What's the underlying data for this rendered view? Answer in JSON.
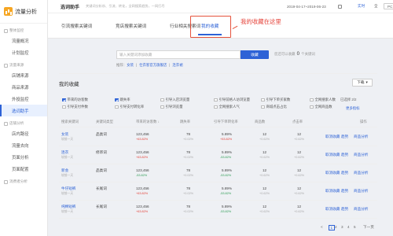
{
  "sidebar": {
    "brand": "流量分析",
    "groups": [
      {
        "label": "整体监控",
        "items": [
          "流量概况",
          "计划监控"
        ]
      },
      {
        "label": "流量来源",
        "items": [
          "店铺来源",
          "商品来源",
          "外投监控",
          "选词助手"
        ]
      },
      {
        "label": "店铺分析",
        "items": [
          "店内路径",
          "流量去向",
          "页面分析",
          "页面配置"
        ]
      },
      {
        "label": "消费者分析",
        "items": []
      }
    ],
    "active_item": "选词助手"
  },
  "topbar": {
    "title": "选词助手",
    "desc": "关键词分析析、引流、转化，全网搜索趋势，一网打尽",
    "date_range": "2019-04-17~2019-06-23",
    "link": "实时",
    "dropdown": "全",
    "device": "PC"
  },
  "tabs": [
    "引流搜索关键词",
    "竞店搜索关键词",
    "行业相关搜索词",
    "我的收藏"
  ],
  "annotation": "我的收藏在这里",
  "search": {
    "placeholder": "输入关键词添加收藏",
    "button": "收藏",
    "hint_prefix": "您还可以收藏",
    "hint_count": "0",
    "hint_suffix": "个关键词",
    "recommend_label": "推荐：",
    "recommend_items": [
      "女装",
      "仕衣客官方旗舰店",
      "连衣裙"
    ]
  },
  "favorites": {
    "title": "我的收藏",
    "download": "下载",
    "checkboxes": [
      {
        "label": "带来的访客数",
        "checked": true
      },
      {
        "label": "跳失率",
        "checked": true
      },
      {
        "label": "引导入店浏览量",
        "checked": false
      },
      {
        "label": "引导前格人访浏览量",
        "checked": false
      },
      {
        "label": "引导下单买家数",
        "checked": false
      },
      {
        "label": "全网搜索人数",
        "checked": false
      },
      {
        "label": "引导支付件数",
        "checked": false
      },
      {
        "label": "引导支付转化率",
        "checked": false
      },
      {
        "label": "引导浏览量",
        "checked": false
      },
      {
        "label": "全网搜索人气",
        "checked": false
      },
      {
        "label": "商城点击占比",
        "checked": false
      },
      {
        "label": "全网商品数",
        "checked": false
      }
    ],
    "selected": "已选择 2/2",
    "more": "更多指标",
    "columns": [
      "搜索关键词",
      "关键词类型",
      "带来的访客数",
      "跳失率",
      "引导下单转化率",
      "商品数",
      "点击率",
      "操作"
    ],
    "rows": [
      {
        "kw": "女装",
        "type": "品类词",
        "visitors": "123,456",
        "visitors_delta": "+63.82%",
        "bounce": "78",
        "bounce_delta": "+0.02%",
        "conv": "5.89%",
        "conv_delta": "+53.82%",
        "items": "12",
        "items_delta": "+0.62%",
        "click": "12",
        "click_delta": "+0.62%",
        "delta_dir": "up"
      },
      {
        "kw": "连衣",
        "type": "修饰词",
        "visitors": "123,456",
        "visitors_delta": "+63.82%",
        "bounce": "78",
        "bounce_delta": "+0.02%",
        "conv": "5.89%",
        "conv_delta": "-53.82%",
        "items": "12",
        "items_delta": "+0.62%",
        "click": "12",
        "click_delta": "+0.62%",
        "delta_dir": "mix"
      },
      {
        "kw": "新会",
        "type": "品类词",
        "visitors": "123,456",
        "visitors_delta": "-53.82%",
        "bounce": "78",
        "bounce_delta": "+0.02%",
        "conv": "5.89%",
        "conv_delta": "-53.82%",
        "items": "12",
        "items_delta": "+0.62%",
        "click": "12",
        "click_delta": "+0.62%",
        "delta_dir": "down"
      },
      {
        "kw": "牛仔短裤",
        "type": "长尾词",
        "visitors": "123,456",
        "visitors_delta": "+63.82%",
        "bounce": "78",
        "bounce_delta": "+0.02%",
        "conv": "5.89%",
        "conv_delta": "-53.82%",
        "items": "12",
        "items_delta": "+0.62%",
        "click": "12",
        "click_delta": "+0.62%",
        "delta_dir": "mix"
      },
      {
        "kw": "纯棉短裤",
        "type": "长尾词",
        "visitors": "123,456",
        "visitors_delta": "+63.82%",
        "bounce": "78",
        "bounce_delta": "+0.02%",
        "conv": "5.89%",
        "conv_delta": "-53.82%",
        "items": "12",
        "items_delta": "+0.62%",
        "click": "12",
        "click_delta": "+0.62%",
        "delta_dir": "mix"
      }
    ],
    "row_sub": "较前一天",
    "row_actions": [
      "取消收藏",
      "趋势",
      "商品分析"
    ]
  },
  "pager": {
    "prev": "<",
    "pages": [
      "1",
      "2",
      "3",
      "4",
      "5"
    ],
    "current": "1",
    "next": "下一页"
  },
  "colors": {
    "accent": "#2d62d6",
    "annotation": "#e5433a",
    "up": "#e5433a",
    "down": "#2e9d55"
  }
}
